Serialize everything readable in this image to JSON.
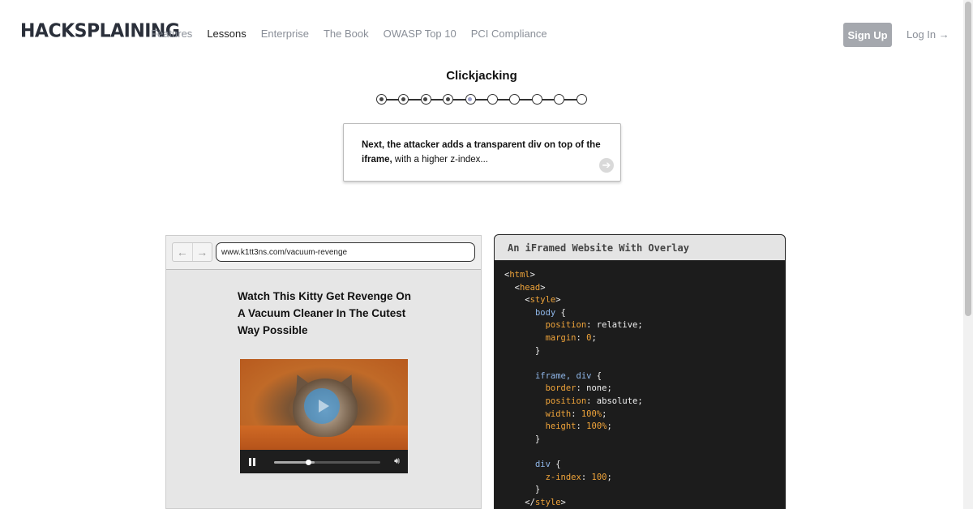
{
  "header": {
    "logo": "HACKSPLAINING",
    "nav": [
      "Features",
      "Lessons",
      "Enterprise",
      "The Book",
      "OWASP Top 10",
      "PCI Compliance"
    ],
    "active_nav": "Lessons",
    "signup_label": "Sign Up",
    "login_label": "Log In →"
  },
  "lesson": {
    "title": "Clickjacking",
    "progress": {
      "total": 10,
      "completed": 4,
      "current": 5
    }
  },
  "instruction": {
    "bold": "Next, the attacker adds a transparent div on top of the iframe,",
    "rest": " with a higher z-index..."
  },
  "browser": {
    "url": "www.k1tt3ns.com/vacuum-revenge",
    "heading": "Watch This Kitty Get Revenge On A Vacuum Cleaner In The Cutest Way Possible",
    "video_progress": 0.3,
    "video_buffered": 0.38
  },
  "code_panel": {
    "caption": "An iFramed Website With Overlay"
  },
  "colors": {
    "signup_bg": "#a5a8ae",
    "code_bg": "#1c1c1c",
    "code_tag": "#f0a43a",
    "code_selector": "#8fb6e8"
  }
}
